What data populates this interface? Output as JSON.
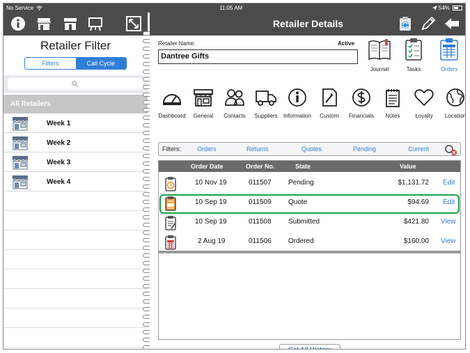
{
  "status_bar": {
    "carrier": "No Service",
    "time": "11:05 AM",
    "battery": "54%"
  },
  "left_panel": {
    "title": "Retailer Filter",
    "segments": [
      "Filters",
      "Call Cycle"
    ],
    "selected_segment": "Call Cycle",
    "search": {
      "placeholder": ""
    },
    "all_retailers_label": "All Retailers",
    "weeks": [
      "Week 1",
      "Week 2",
      "Week 3",
      "Week 4"
    ]
  },
  "right_panel": {
    "title": "Retailer Details",
    "retailer_name_label": "Retailer Name:",
    "retailer_name": "Dantree Gifts",
    "status": "Active",
    "top_icons": [
      {
        "label": "Journal",
        "icon": "journal-icon"
      },
      {
        "label": "Tasks",
        "icon": "tasks-icon"
      },
      {
        "label": "Orders",
        "icon": "orders-icon",
        "selected": true
      }
    ],
    "categories": [
      {
        "label": "Dashboard",
        "icon": "dashboard-icon"
      },
      {
        "label": "General",
        "icon": "store-icon"
      },
      {
        "label": "Contacts",
        "icon": "contacts-icon"
      },
      {
        "label": "Suppliers",
        "icon": "truck-icon"
      },
      {
        "label": "Information",
        "icon": "info-icon"
      },
      {
        "label": "Custom",
        "icon": "custom-icon"
      },
      {
        "label": "Financials",
        "icon": "dollar-icon"
      },
      {
        "label": "Notes",
        "icon": "notes-icon"
      },
      {
        "label": "Loyalty",
        "icon": "heart-icon"
      },
      {
        "label": "Location",
        "icon": "globe-icon"
      }
    ],
    "filters_label": "Filters:",
    "filters": [
      "Orders",
      "Returns",
      "Quotes",
      "Pending",
      "Current"
    ],
    "orders_table": {
      "columns": [
        "Order Date",
        "Order No.",
        "State",
        "Value"
      ],
      "rows": [
        {
          "date": "10 Nov 19",
          "number": "011507",
          "state": "Pending",
          "value": "$1,131.72",
          "action": "Edit",
          "icon": "pending-clipboard-icon"
        },
        {
          "date": "10 Sep 19",
          "number": "011509",
          "state": "Quote",
          "value": "$94.69",
          "action": "Edit",
          "icon": "quote-clipboard-icon",
          "highlighted": true
        },
        {
          "date": "10 Sep 19",
          "number": "011508",
          "state": "Submitted",
          "value": "$421.80",
          "action": "View",
          "icon": "submitted-clipboard-icon"
        },
        {
          "date": "2 Aug 19",
          "number": "011506",
          "state": "Ordered",
          "value": "$160.00",
          "action": "View",
          "icon": "ordered-clipboard-icon"
        }
      ]
    },
    "history_button": "Get All History"
  },
  "colors": {
    "toolbar": "#4b4b4b",
    "accent": "#2f7fd8",
    "highlight": "#1aa24a"
  }
}
